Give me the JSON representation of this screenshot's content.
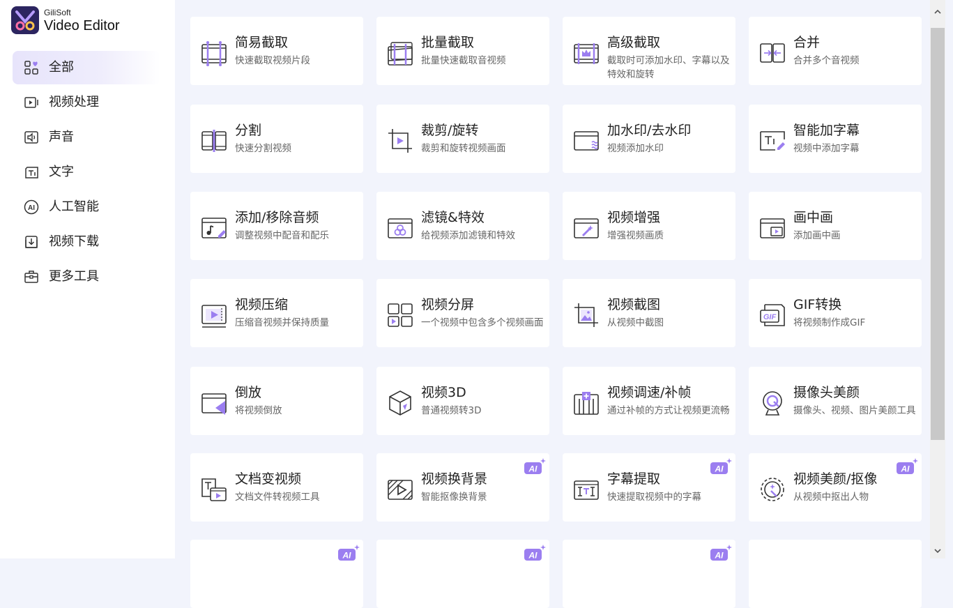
{
  "app": {
    "brand": "GiliSoft",
    "product": "Video Editor"
  },
  "sidebar": {
    "items": [
      {
        "label": "全部",
        "icon": "grid-heart-icon",
        "active": true
      },
      {
        "label": "视频处理",
        "icon": "video-play-icon"
      },
      {
        "label": "声音",
        "icon": "speaker-icon"
      },
      {
        "label": "文字",
        "icon": "text-icon"
      },
      {
        "label": "人工智能",
        "icon": "ai-icon"
      },
      {
        "label": "视频下载",
        "icon": "download-icon"
      },
      {
        "label": "更多工具",
        "icon": "toolbox-icon"
      }
    ]
  },
  "tools": [
    {
      "title": "简易截取",
      "desc": "快速截取视频片段",
      "icon": "simple-cut-icon"
    },
    {
      "title": "批量截取",
      "desc": "批量快速截取音视频",
      "icon": "batch-cut-icon"
    },
    {
      "title": "高级截取",
      "desc": "截取时可添加水印、字幕以及特效和旋转",
      "icon": "advanced-cut-icon"
    },
    {
      "title": "合并",
      "desc": "合并多个音视频",
      "icon": "merge-icon"
    },
    {
      "title": "分割",
      "desc": "快速分割视频",
      "icon": "split-icon"
    },
    {
      "title": "裁剪/旋转",
      "desc": "裁剪和旋转视频画面",
      "icon": "crop-rotate-icon"
    },
    {
      "title": "加水印/去水印",
      "desc": "视频添加水印",
      "icon": "watermark-icon"
    },
    {
      "title": "智能加字幕",
      "desc": "视频中添加字幕",
      "icon": "smart-subtitle-icon"
    },
    {
      "title": "添加/移除音频",
      "desc": "调整视频中配音和配乐",
      "icon": "audio-edit-icon"
    },
    {
      "title": "滤镜&特效",
      "desc": "给视频添加滤镜和特效",
      "icon": "filter-icon"
    },
    {
      "title": "视频增强",
      "desc": "增强视频画质",
      "icon": "enhance-icon"
    },
    {
      "title": "画中画",
      "desc": "添加画中画",
      "icon": "pip-icon"
    },
    {
      "title": "视频压缩",
      "desc": "压缩音视频并保持质量",
      "icon": "compress-icon"
    },
    {
      "title": "视频分屏",
      "desc": "一个视频中包含多个视频画面",
      "icon": "split-screen-icon"
    },
    {
      "title": "视频截图",
      "desc": "从视频中截图",
      "icon": "screenshot-icon"
    },
    {
      "title": "GIF转换",
      "desc": "将视频制作成GIF",
      "icon": "gif-icon"
    },
    {
      "title": "倒放",
      "desc": "将视频倒放",
      "icon": "reverse-icon"
    },
    {
      "title": "视频3D",
      "desc": "普通视频转3D",
      "icon": "cube-3d-icon"
    },
    {
      "title": "视频调速/补帧",
      "desc": "通过补帧的方式让视频更流畅",
      "icon": "speed-icon"
    },
    {
      "title": "摄像头美颜",
      "desc": "摄像头、视频、图片美颜工具",
      "icon": "webcam-beauty-icon"
    },
    {
      "title": "文档变视频",
      "desc": "文档文件转视频工具",
      "icon": "doc-to-video-icon"
    },
    {
      "title": "视频换背景",
      "desc": "智能抠像换背景",
      "icon": "background-replace-icon",
      "ai": true
    },
    {
      "title": "字幕提取",
      "desc": "快速提取视频中的字幕",
      "icon": "subtitle-extract-icon",
      "ai": true
    },
    {
      "title": "视频美颜/抠像",
      "desc": "从视频中抠出人物",
      "icon": "beauty-matting-icon",
      "ai": true
    },
    {
      "title": "",
      "desc": "",
      "icon": "blank-icon",
      "ai": true
    },
    {
      "title": "",
      "desc": "",
      "icon": "blank-icon",
      "ai": true
    },
    {
      "title": "",
      "desc": "",
      "icon": "blank-icon",
      "ai": true
    },
    {
      "title": "",
      "desc": "",
      "icon": "blank-icon"
    }
  ],
  "ai_badge": "AI",
  "colors": {
    "accent": "#9b7ef0",
    "icon_stroke": "#333333",
    "active_nav_bg": "#e9e6fb",
    "page_bg": "#f2f4fc"
  }
}
